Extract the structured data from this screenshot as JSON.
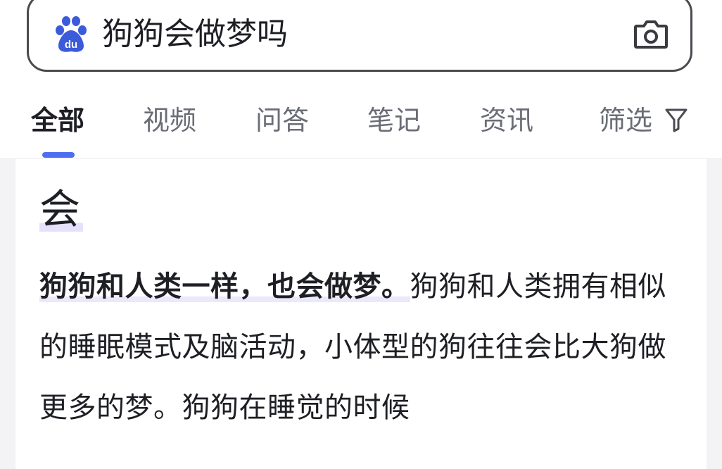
{
  "search": {
    "query": "狗狗会做梦吗",
    "logo_text": "du"
  },
  "tabs": [
    {
      "label": "全部",
      "active": true
    },
    {
      "label": "视频"
    },
    {
      "label": "问答"
    },
    {
      "label": "笔记"
    },
    {
      "label": "资讯"
    },
    {
      "label": "筛选"
    }
  ],
  "result": {
    "answer": "会",
    "highlight": "狗狗和人类一样，也会做梦。",
    "rest": "狗狗和人类拥有相似的睡眠模式及脑活动，小体型的狗往往会比大狗做更多的梦。狗狗在睡觉的时候"
  },
  "colors": {
    "accent": "#4e6ef2",
    "text": "#1e1f24",
    "muted": "#6b6d76"
  }
}
